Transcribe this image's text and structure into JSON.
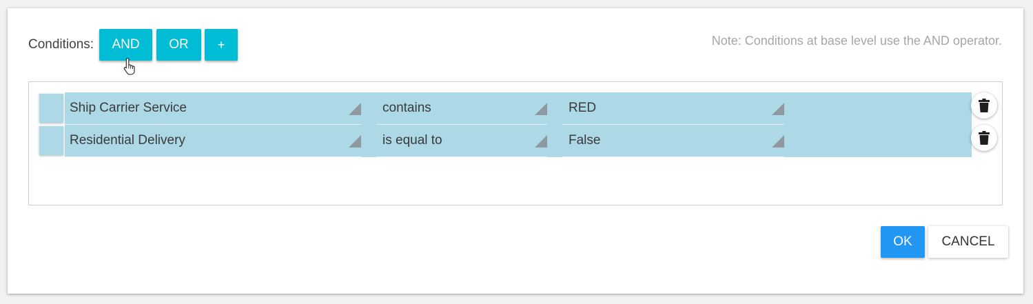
{
  "header": {
    "conditions_label": "Conditions:",
    "and_label": "AND",
    "or_label": "OR",
    "add_label": "+",
    "note": "Note: Conditions at base level use the AND operator."
  },
  "conditions": [
    {
      "field": "Ship Carrier Service",
      "operator": "contains",
      "value": "RED"
    },
    {
      "field": "Residential Delivery",
      "operator": "is equal to",
      "value": "False"
    }
  ],
  "footer": {
    "ok_label": "OK",
    "cancel_label": "CANCEL"
  },
  "colors": {
    "operator_button": "#00bcd4",
    "row_background": "#add8e6",
    "ok_button": "#2196f3"
  },
  "icons": {
    "delete": "trash-icon",
    "dropdown": "dropdown-triangle-icon",
    "cursor": "hand-pointer-icon"
  }
}
